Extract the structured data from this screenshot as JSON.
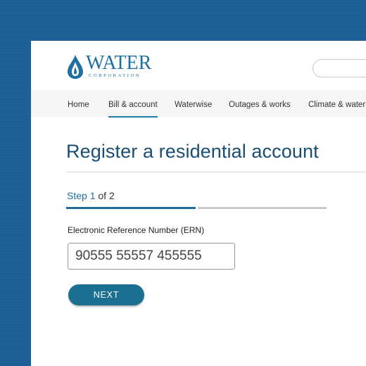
{
  "brand": {
    "name": "WATER",
    "subtitle": "CORPORATION"
  },
  "nav": {
    "items": [
      {
        "label": "Home",
        "active": false
      },
      {
        "label": "Bill & account",
        "active": true
      },
      {
        "label": "Waterwise",
        "active": false
      },
      {
        "label": "Outages & works",
        "active": false
      },
      {
        "label": "Climate & water",
        "active": false
      }
    ]
  },
  "page": {
    "title": "Register a residential account"
  },
  "stepper": {
    "prefix": "Step",
    "current": "1",
    "suffix": "of 2",
    "progress": 0.5
  },
  "form": {
    "ern_label": "Electronic Reference Number (ERN)",
    "ern_value": "90555 55557 455555",
    "next_label": "NEXT"
  },
  "colors": {
    "background": "#1b5f96",
    "accent": "#1e6fa0",
    "title": "#1a4e74",
    "button": "#1b6f91"
  },
  "icons": {
    "logo": "water-drop-icon"
  }
}
